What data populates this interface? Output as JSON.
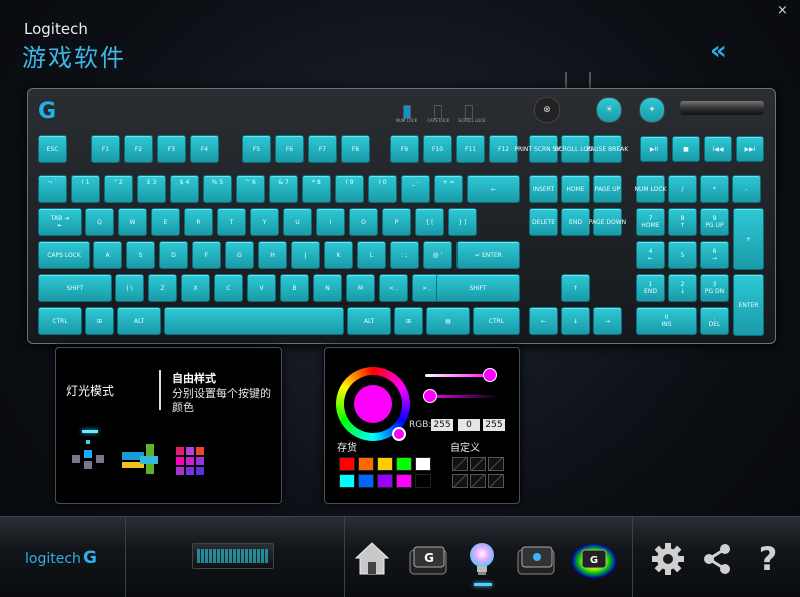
{
  "window": {
    "brand": "Logitech",
    "title": "游戏软件",
    "close": "×",
    "collapse": "«"
  },
  "keyboard": {
    "logo": "G",
    "indicators": [
      "NUM LOCK",
      "CAPS LOCK",
      "SCROLL LOCK"
    ],
    "fn_row": [
      "ESC",
      "F1",
      "F2",
      "F3",
      "F4",
      "F5",
      "F6",
      "F7",
      "F8",
      "F9",
      "F10",
      "F11",
      "F12"
    ],
    "sys_keys": [
      "PRINT SCRN SYSRQ",
      "SCROLL LOCK",
      "PAUSE BREAK"
    ],
    "media_keys": [
      "▶II",
      "■",
      "I◀◀",
      "▶▶I"
    ],
    "number_row": [
      "¬ `",
      "! 1",
      "\" 2",
      "£ 3",
      "$ 4",
      "% 5",
      "^ 6",
      "& 7",
      "* 8",
      "( 9",
      ") 0",
      "_ -",
      "+ =",
      "←"
    ],
    "nav_row1": [
      "INSERT",
      "HOME",
      "PAGE UP"
    ],
    "num_row1": [
      "NUM LOCK",
      "/",
      "*",
      "-"
    ],
    "qwerty_row": [
      "TAB ⇥\n⇤",
      "Q",
      "W",
      "E",
      "R",
      "T",
      "Y",
      "U",
      "I",
      "O",
      "P",
      "{ [",
      "} ]"
    ],
    "nav_row2": [
      "DELETE",
      "END",
      "PAGE DOWN"
    ],
    "num_row2": [
      "7\nHOME",
      "8\n↑",
      "9\nPG UP",
      "+"
    ],
    "home_row": [
      "CAPS LOCK",
      "A",
      "S",
      "D",
      "F",
      "G",
      "H",
      "J",
      "K",
      "L",
      ": ;",
      "@ '",
      "~ #",
      "↵ ENTER"
    ],
    "num_row3": [
      "4\n←",
      "5",
      "6\n→"
    ],
    "shift_row": [
      "SHIFT",
      "| \\",
      "Z",
      "X",
      "C",
      "V",
      "B",
      "N",
      "M",
      "< ,",
      "> .",
      "? /",
      "SHIFT"
    ],
    "arrow_up": "↑",
    "num_row4": [
      "1\nEND",
      "2\n↓",
      "3\nPG DN",
      "ENTER"
    ],
    "bottom_row": [
      "CTRL",
      "⊞",
      "ALT",
      "",
      "ALT",
      "⊞",
      "▤",
      "CTRL"
    ],
    "arrows": [
      "←",
      "↓",
      "→"
    ],
    "num_row5": [
      "0\nINS",
      ".\nDEL"
    ]
  },
  "lighting_panel": {
    "mode_label": "灯光模式",
    "style_title": "自由样式",
    "style_desc_line1": "分别设置每个按键的",
    "style_desc_line2": "颜色"
  },
  "color_panel": {
    "rgb_label": "RGB:",
    "rgb": {
      "r": "255",
      "g": "0",
      "b": "255"
    },
    "selected_color": "#ff00ff",
    "presets_label": "存货",
    "custom_label": "自定义",
    "presets": [
      "#ff0000",
      "#ff6600",
      "#ffcc00",
      "#00ff00",
      "#ffffff",
      "#00ffff",
      "#0066ff",
      "#9900ff",
      "#ff00ff",
      "#000000"
    ],
    "custom_slots": 6
  },
  "bottom_bar": {
    "logo_text": "logitech",
    "logo_mark": "G",
    "nav": [
      "home-icon",
      "g-key-icon",
      "lighting-bulb-icon",
      "gear-key-icon",
      "heatmap-icon",
      "settings-gear-icon",
      "share-icon",
      "help-icon"
    ],
    "help_glyph": "?"
  },
  "colors": {
    "accent": "#22b0e6",
    "keycap": "#1fb4c2"
  }
}
